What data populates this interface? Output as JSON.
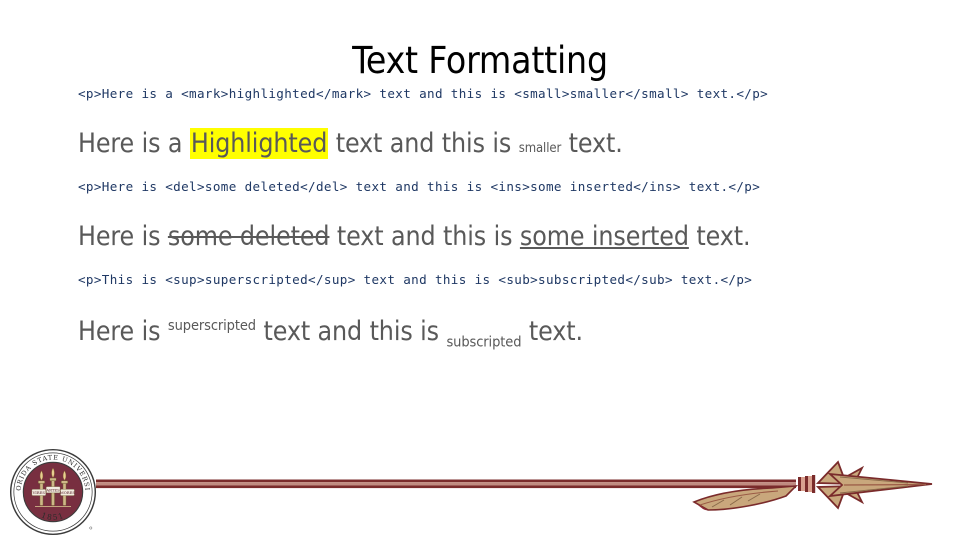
{
  "slide": {
    "title": "Text Formatting",
    "background_color": "#FFFFFF",
    "title_color": "#000000",
    "code_color": "#1F3864",
    "rendered_text_color": "#595959",
    "highlight_color": "#FFFF00",
    "brand_garnet": "#782F40",
    "brand_gold": "#CEB888"
  },
  "examples": [
    {
      "code": "<p>Here is a <mark>highlighted</mark> text and this is <small>smaller</small> text.</p>",
      "rendered": {
        "prefix": "Here is a ",
        "mark": "Highlighted",
        "middle": " text and this is ",
        "small": "smaller",
        "suffix": " text."
      }
    },
    {
      "code": "<p>Here is <del>some deleted</del> text and this is <ins>some inserted</ins> text.</p>",
      "rendered": {
        "prefix": "Here is ",
        "del": "some deleted",
        "middle": " text and this is ",
        "ins": "some inserted",
        "suffix": " text."
      }
    },
    {
      "code": "<p>This is <sup>superscripted</sup> text and this is <sub>subscripted</sub> text.</p>",
      "rendered": {
        "prefix": "Here is ",
        "sup": "superscripted",
        "middle": " text and this is ",
        "sub": "subscripted",
        "suffix": " text."
      }
    }
  ],
  "footer": {
    "seal": {
      "name": "florida-state-university-seal",
      "outer_text": "FLORIDA STATE UNIVERSITY",
      "year": "1851",
      "torch_labels": [
        "VIRES",
        "ARTES",
        "MORES"
      ]
    },
    "spear": {
      "name": "fsu-spear-graphic"
    }
  }
}
